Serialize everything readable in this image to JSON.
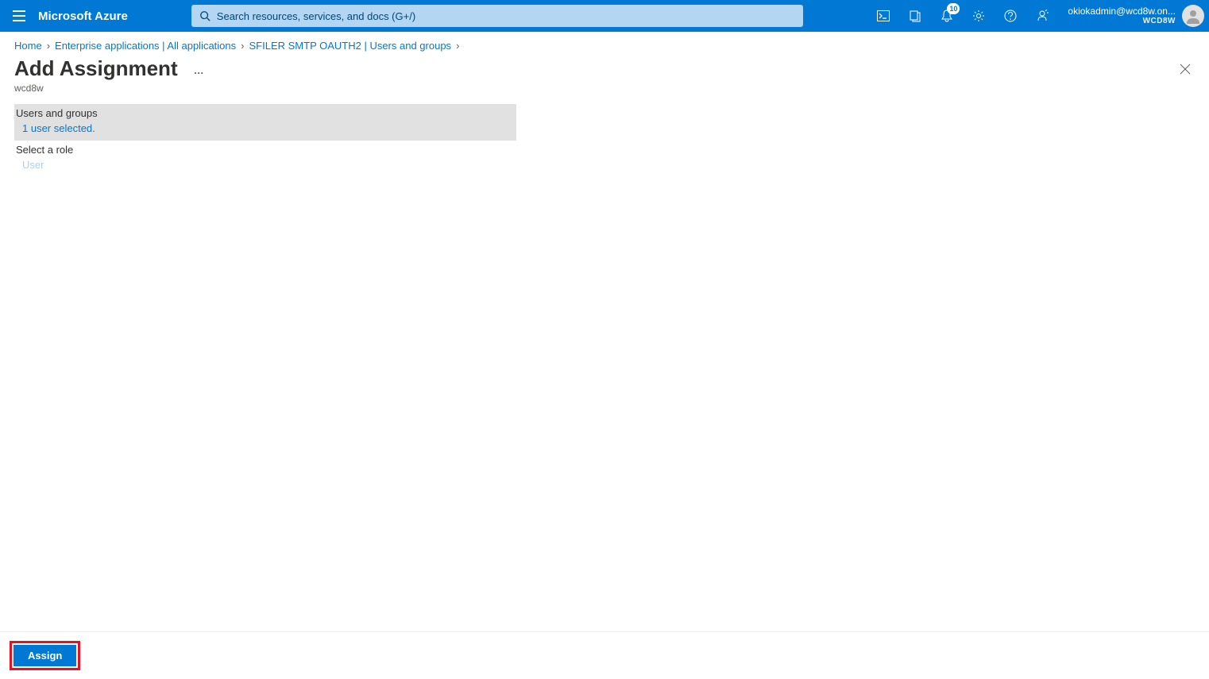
{
  "header": {
    "brand": "Microsoft Azure",
    "search_placeholder": "Search resources, services, and docs (G+/)",
    "notification_count": "10",
    "account_email": "okiokadmin@wcd8w.on...",
    "account_tenant": "WCD8W"
  },
  "breadcrumb": {
    "items": [
      "Home",
      "Enterprise applications | All applications",
      "SFILER SMTP OAUTH2 | Users and groups"
    ]
  },
  "page": {
    "title": "Add Assignment",
    "subtitle": "wcd8w"
  },
  "form": {
    "users_groups_label": "Users and groups",
    "users_groups_value": "1 user selected.",
    "role_label": "Select a role",
    "role_value": "User"
  },
  "footer": {
    "assign_label": "Assign"
  }
}
